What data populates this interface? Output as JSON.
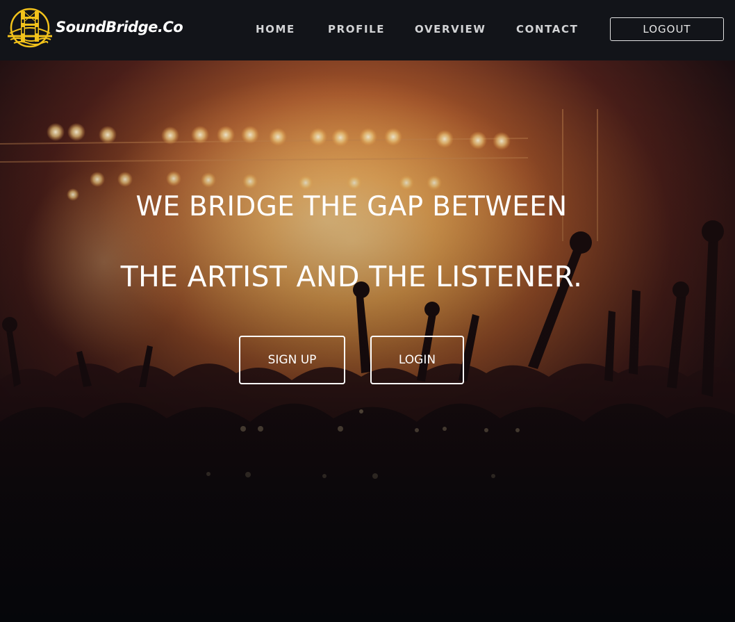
{
  "brand": {
    "name": "SoundBridge.Co",
    "logo_icon": "golden-gate-bridge-logo-icon",
    "logo_color": "#f2c21b"
  },
  "nav": {
    "items": [
      {
        "label": "HOME"
      },
      {
        "label": "PROFILE"
      },
      {
        "label": "OVERVIEW"
      },
      {
        "label": "CONTACT"
      }
    ],
    "logout_label": "LOGOUT"
  },
  "hero": {
    "headline_line1": "WE BRIDGE THE GAP BETWEEN",
    "headline_line2": "THE ARTIST AND THE LISTENER.",
    "signup_label": "SIGN UP",
    "login_label": "LOGIN",
    "background": "concert-crowd-stage-lights-image"
  },
  "colors": {
    "navbar_bg": "#121419",
    "nav_text": "#d2d3d5",
    "hero_text": "#ffffff",
    "accent": "#f2c21b"
  }
}
